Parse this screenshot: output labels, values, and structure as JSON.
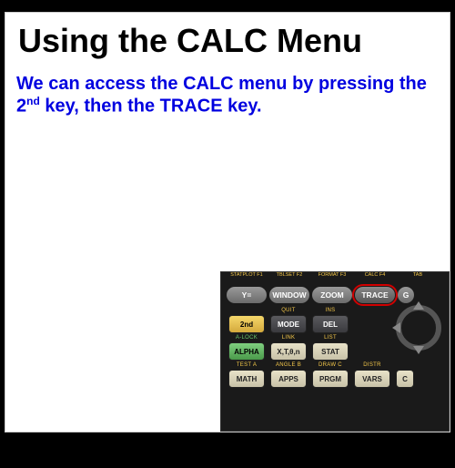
{
  "title": "Using the CALC Menu",
  "body_parts": {
    "p1": "We can access the CALC menu by pressing the 2",
    "sup": "nd",
    "p2": " key, then the TRACE key."
  },
  "top_labels": [
    "STATPLOT F1",
    "TBLSET F2",
    "FORMAT F3",
    "CALC F4",
    "TAB"
  ],
  "top_buttons": {
    "y": "Y=",
    "window": "WINDOW",
    "zoom": "ZOOM",
    "trace": "TRACE",
    "g": "G"
  },
  "row2_labels": {
    "quit": "QUIT",
    "ins": "INS"
  },
  "row2": {
    "second": "2nd",
    "mode": "MODE",
    "del": "DEL"
  },
  "row3_labels": {
    "alock": "A-LOCK",
    "link": "LINK",
    "list": "LIST"
  },
  "row3": {
    "alpha": "ALPHA",
    "xt": "X,T,θ,n",
    "stat": "STAT"
  },
  "row4_labels": {
    "test": "TEST A",
    "angle": "ANGLE B",
    "draw": "DRAW C",
    "distr": "DISTR"
  },
  "row4": {
    "math": "MATH",
    "apps": "APPS",
    "prgm": "PRGM",
    "vars": "VARS",
    "c": "C"
  }
}
